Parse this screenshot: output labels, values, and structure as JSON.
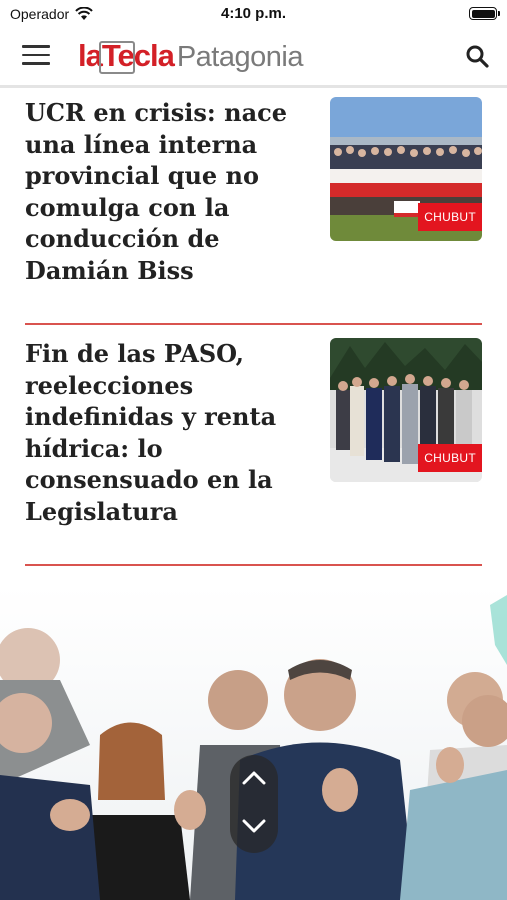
{
  "status_bar": {
    "carrier": "Operador",
    "time": "4:10 p.m."
  },
  "header": {
    "logo_main": "laTecla",
    "logo_sub": "Patagonia"
  },
  "articles": [
    {
      "headline": "UCR en crisis: nace una línea interna provincial que no comulga con la conducción de Damián Biss",
      "tag": "CHUBUT"
    },
    {
      "headline": "Fin de las PASO, reelecciones indefinidas y renta hídrica: lo consensuado en la Legislatura",
      "tag": "CHUBUT"
    }
  ],
  "colors": {
    "brand_red": "#d32027",
    "tag_red": "#e3151f",
    "divider": "#d9534f"
  },
  "icons": {
    "menu": "hamburger-icon",
    "search": "search-icon",
    "scroll_up": "chevron-up-icon",
    "scroll_down": "chevron-down-icon"
  }
}
